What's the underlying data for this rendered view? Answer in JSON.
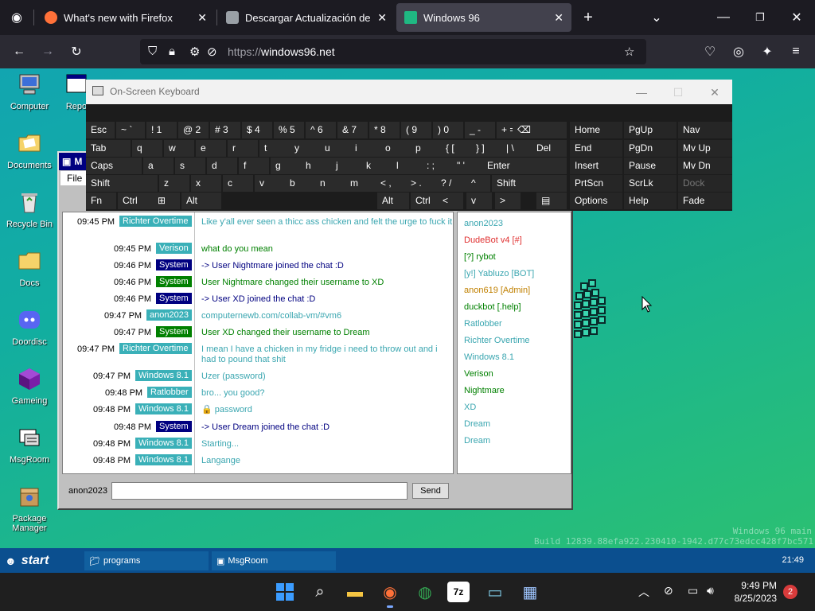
{
  "browser": {
    "tabs": [
      {
        "title": "What's new with Firefox",
        "active": false
      },
      {
        "title": "Descargar Actualización de seguridad",
        "active": false
      },
      {
        "title": "Windows 96",
        "active": true
      }
    ],
    "url_protocol": "https://",
    "url_host": "windows96.net"
  },
  "desktop": {
    "icons": [
      {
        "label": "Computer"
      },
      {
        "label": "Documents"
      },
      {
        "label": "Recycle Bin"
      },
      {
        "label": "Docs"
      },
      {
        "label": "Doordisc"
      },
      {
        "label": "Gameing"
      },
      {
        "label": "MsgRoom"
      },
      {
        "label": "Package Manager"
      }
    ],
    "partial_icon_label": "Repo",
    "build_line1": "Windows 96 main",
    "build_line2": "Build 12839.88efa922.230410-1942.d77c73edcc428f7bc571"
  },
  "osk": {
    "title": "On-Screen Keyboard",
    "rows": [
      [
        "Esc",
        "~ `",
        "! 1",
        "@ 2",
        "# 3",
        "$ 4",
        "% 5",
        "^ 6",
        "& 7",
        "* 8",
        "( 9",
        ") 0",
        "_ -",
        "+ =",
        "⌫"
      ],
      [
        "Tab",
        "q",
        "w",
        "e",
        "r",
        "t",
        "y",
        "u",
        "i",
        "o",
        "p",
        "{ [",
        "} ]",
        "| \\",
        "Del"
      ],
      [
        "Caps",
        "a",
        "s",
        "d",
        "f",
        "g",
        "h",
        "j",
        "k",
        "l",
        ": ;",
        "\" '",
        "Enter"
      ],
      [
        "Shift",
        "z",
        "x",
        "c",
        "v",
        "b",
        "n",
        "m",
        "< ,",
        "> .",
        "? /",
        "^",
        "Shift"
      ],
      [
        "Fn",
        "Ctrl",
        "⊞",
        "Alt",
        "Alt",
        "Ctrl",
        "<",
        "v",
        ">",
        "▤"
      ]
    ],
    "nav_keys": [
      [
        "Home",
        "PgUp",
        "Nav"
      ],
      [
        "End",
        "PgDn",
        "Mv Up"
      ],
      [
        "Insert",
        "Pause",
        "Mv Dn"
      ],
      [
        "PrtScn",
        "ScrLk",
        "Dock"
      ],
      [
        "Options",
        "Help",
        "Fade"
      ]
    ]
  },
  "msgroom": {
    "title": "M",
    "menu_file": "File",
    "messages": [
      {
        "time": "09:45 PM",
        "user": "Richter Overtime",
        "badge": "teal",
        "text": "Like y'all ever seen a thicc ass chicken and felt the urge to fuck it",
        "style": "teal"
      },
      {
        "time": "09:45 PM",
        "user": "Verison",
        "badge": "teal",
        "text": "what do you mean",
        "style": "green"
      },
      {
        "time": "09:46 PM",
        "user": "System",
        "badge": "sys",
        "text": "-> User Nightmare joined the chat :D",
        "style": "navy"
      },
      {
        "time": "09:46 PM",
        "user": "System",
        "badge": "sysg",
        "text": "User Nightmare changed their username to XD",
        "style": "green"
      },
      {
        "time": "09:46 PM",
        "user": "System",
        "badge": "sys",
        "text": "-> User XD joined the chat :D",
        "style": "navy"
      },
      {
        "time": "09:47 PM",
        "user": "anon2023",
        "badge": "teal",
        "text": "computernewb.com/collab-vm/#vm6",
        "style": "teal"
      },
      {
        "time": "09:47 PM",
        "user": "System",
        "badge": "sysg",
        "text": "User XD changed their username to Dream",
        "style": "green"
      },
      {
        "time": "09:47 PM",
        "user": "Richter Overtime",
        "badge": "teal",
        "text": "I mean I have a chicken in my fridge i need to throw out and i had to pound that shit",
        "style": "teal"
      },
      {
        "time": "09:47 PM",
        "user": "Windows 8.1",
        "badge": "teal",
        "text": "Uzer (password)",
        "style": "teal"
      },
      {
        "time": "09:48 PM",
        "user": "Ratlobber",
        "badge": "teal",
        "text": "bro... you good?",
        "style": "teal"
      },
      {
        "time": "09:48 PM",
        "user": "Windows 8.1",
        "badge": "teal",
        "text": "🔒 password",
        "style": "teal"
      },
      {
        "time": "09:48 PM",
        "user": "System",
        "badge": "sys",
        "text": "-> User Dream joined the chat :D",
        "style": "navy"
      },
      {
        "time": "09:48 PM",
        "user": "Windows 8.1",
        "badge": "teal",
        "text": "Starting...",
        "style": "teal"
      },
      {
        "time": "09:48 PM",
        "user": "Windows 8.1",
        "badge": "teal",
        "text": "Langange",
        "style": "teal"
      }
    ],
    "users": [
      {
        "name": "anon2023",
        "color": "#3aa6b0"
      },
      {
        "name": "DudeBot v4 [#]",
        "color": "#e03030"
      },
      {
        "name": "[?] rybot",
        "color": "#008000"
      },
      {
        "name": "[y!] Yabluzo [BOT]",
        "color": "#3aa6b0"
      },
      {
        "name": "anon619 [Admin]",
        "color": "#c08000"
      },
      {
        "name": "duckbot [.help]",
        "color": "#008000"
      },
      {
        "name": "Ratlobber",
        "color": "#3aa6b0"
      },
      {
        "name": "Richter Overtime",
        "color": "#3aa6b0"
      },
      {
        "name": "Windows 8.1",
        "color": "#3aa6b0"
      },
      {
        "name": "Verison",
        "color": "#008000"
      },
      {
        "name": "Nightmare",
        "color": "#008000"
      },
      {
        "name": "XD",
        "color": "#3aa6b0"
      },
      {
        "name": "Dream",
        "color": "#3aa6b0"
      },
      {
        "name": "Dream",
        "color": "#3aa6b0"
      }
    ],
    "nick": "anon2023",
    "input_value": "",
    "send_label": "Send"
  },
  "w96_taskbar": {
    "start_label": "start",
    "tasks": [
      {
        "label": "programs"
      },
      {
        "label": "MsgRoom"
      }
    ],
    "clock": "21:49"
  },
  "win11": {
    "time": "9:49 PM",
    "date": "8/25/2023",
    "notifications": "2"
  }
}
